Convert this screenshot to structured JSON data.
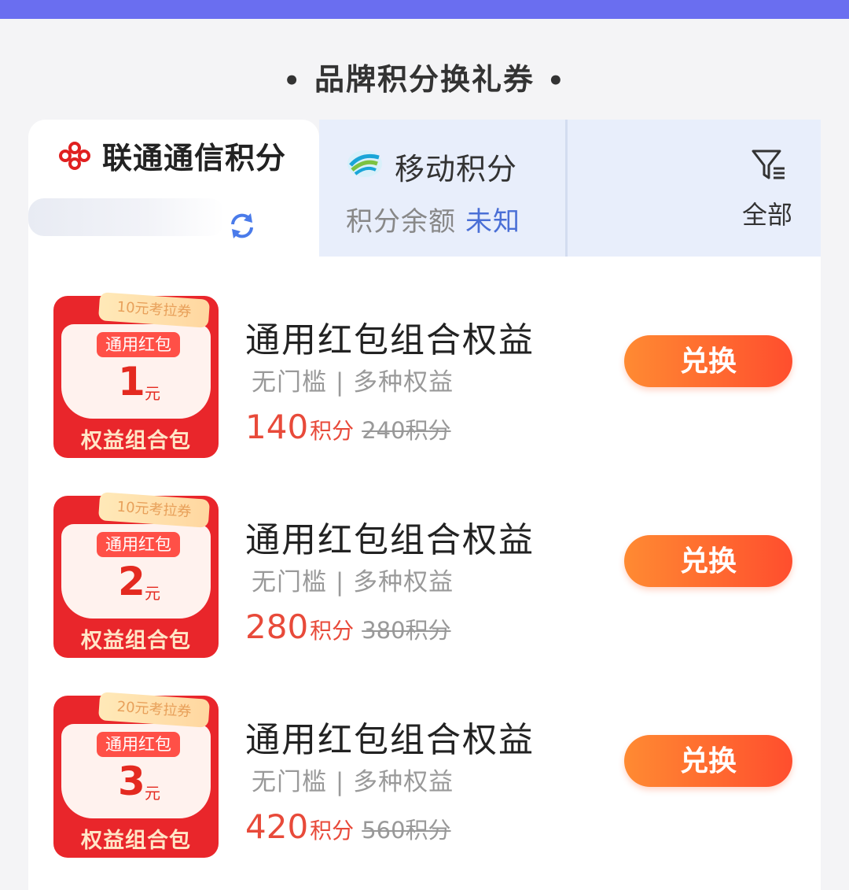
{
  "header": {
    "title": "品牌积分换礼券",
    "dot_left": "•",
    "dot_right": "•"
  },
  "tabs": {
    "unicom": {
      "title": "联通通信积分"
    },
    "mobile": {
      "title": "移动积分",
      "balance_label": "积分余额",
      "balance_value": "未知"
    },
    "filter": {
      "label": "全部"
    }
  },
  "items": [
    {
      "tag": "10元考拉券",
      "sub_label": "通用红包",
      "amount": "1",
      "unit": "元",
      "footer": "权益组合包",
      "title": "通用红包组合权益",
      "desc": "无门槛 | 多种权益",
      "price": "140",
      "price_label": "积分",
      "old_price": "240积分",
      "button": "兑换"
    },
    {
      "tag": "10元考拉券",
      "sub_label": "通用红包",
      "amount": "2",
      "unit": "元",
      "footer": "权益组合包",
      "title": "通用红包组合权益",
      "desc": "无门槛 | 多种权益",
      "price": "280",
      "price_label": "积分",
      "old_price": "380积分",
      "button": "兑换"
    },
    {
      "tag": "20元考拉券",
      "sub_label": "通用红包",
      "amount": "3",
      "unit": "元",
      "footer": "权益组合包",
      "title": "通用红包组合权益",
      "desc": "无门槛 | 多种权益",
      "price": "420",
      "price_label": "积分",
      "old_price": "560积分",
      "button": "兑换"
    }
  ],
  "colors": {
    "accent": "#6a6ef0",
    "price": "#e84a3a",
    "button": "#ff5a30",
    "link": "#4a6fd6"
  }
}
